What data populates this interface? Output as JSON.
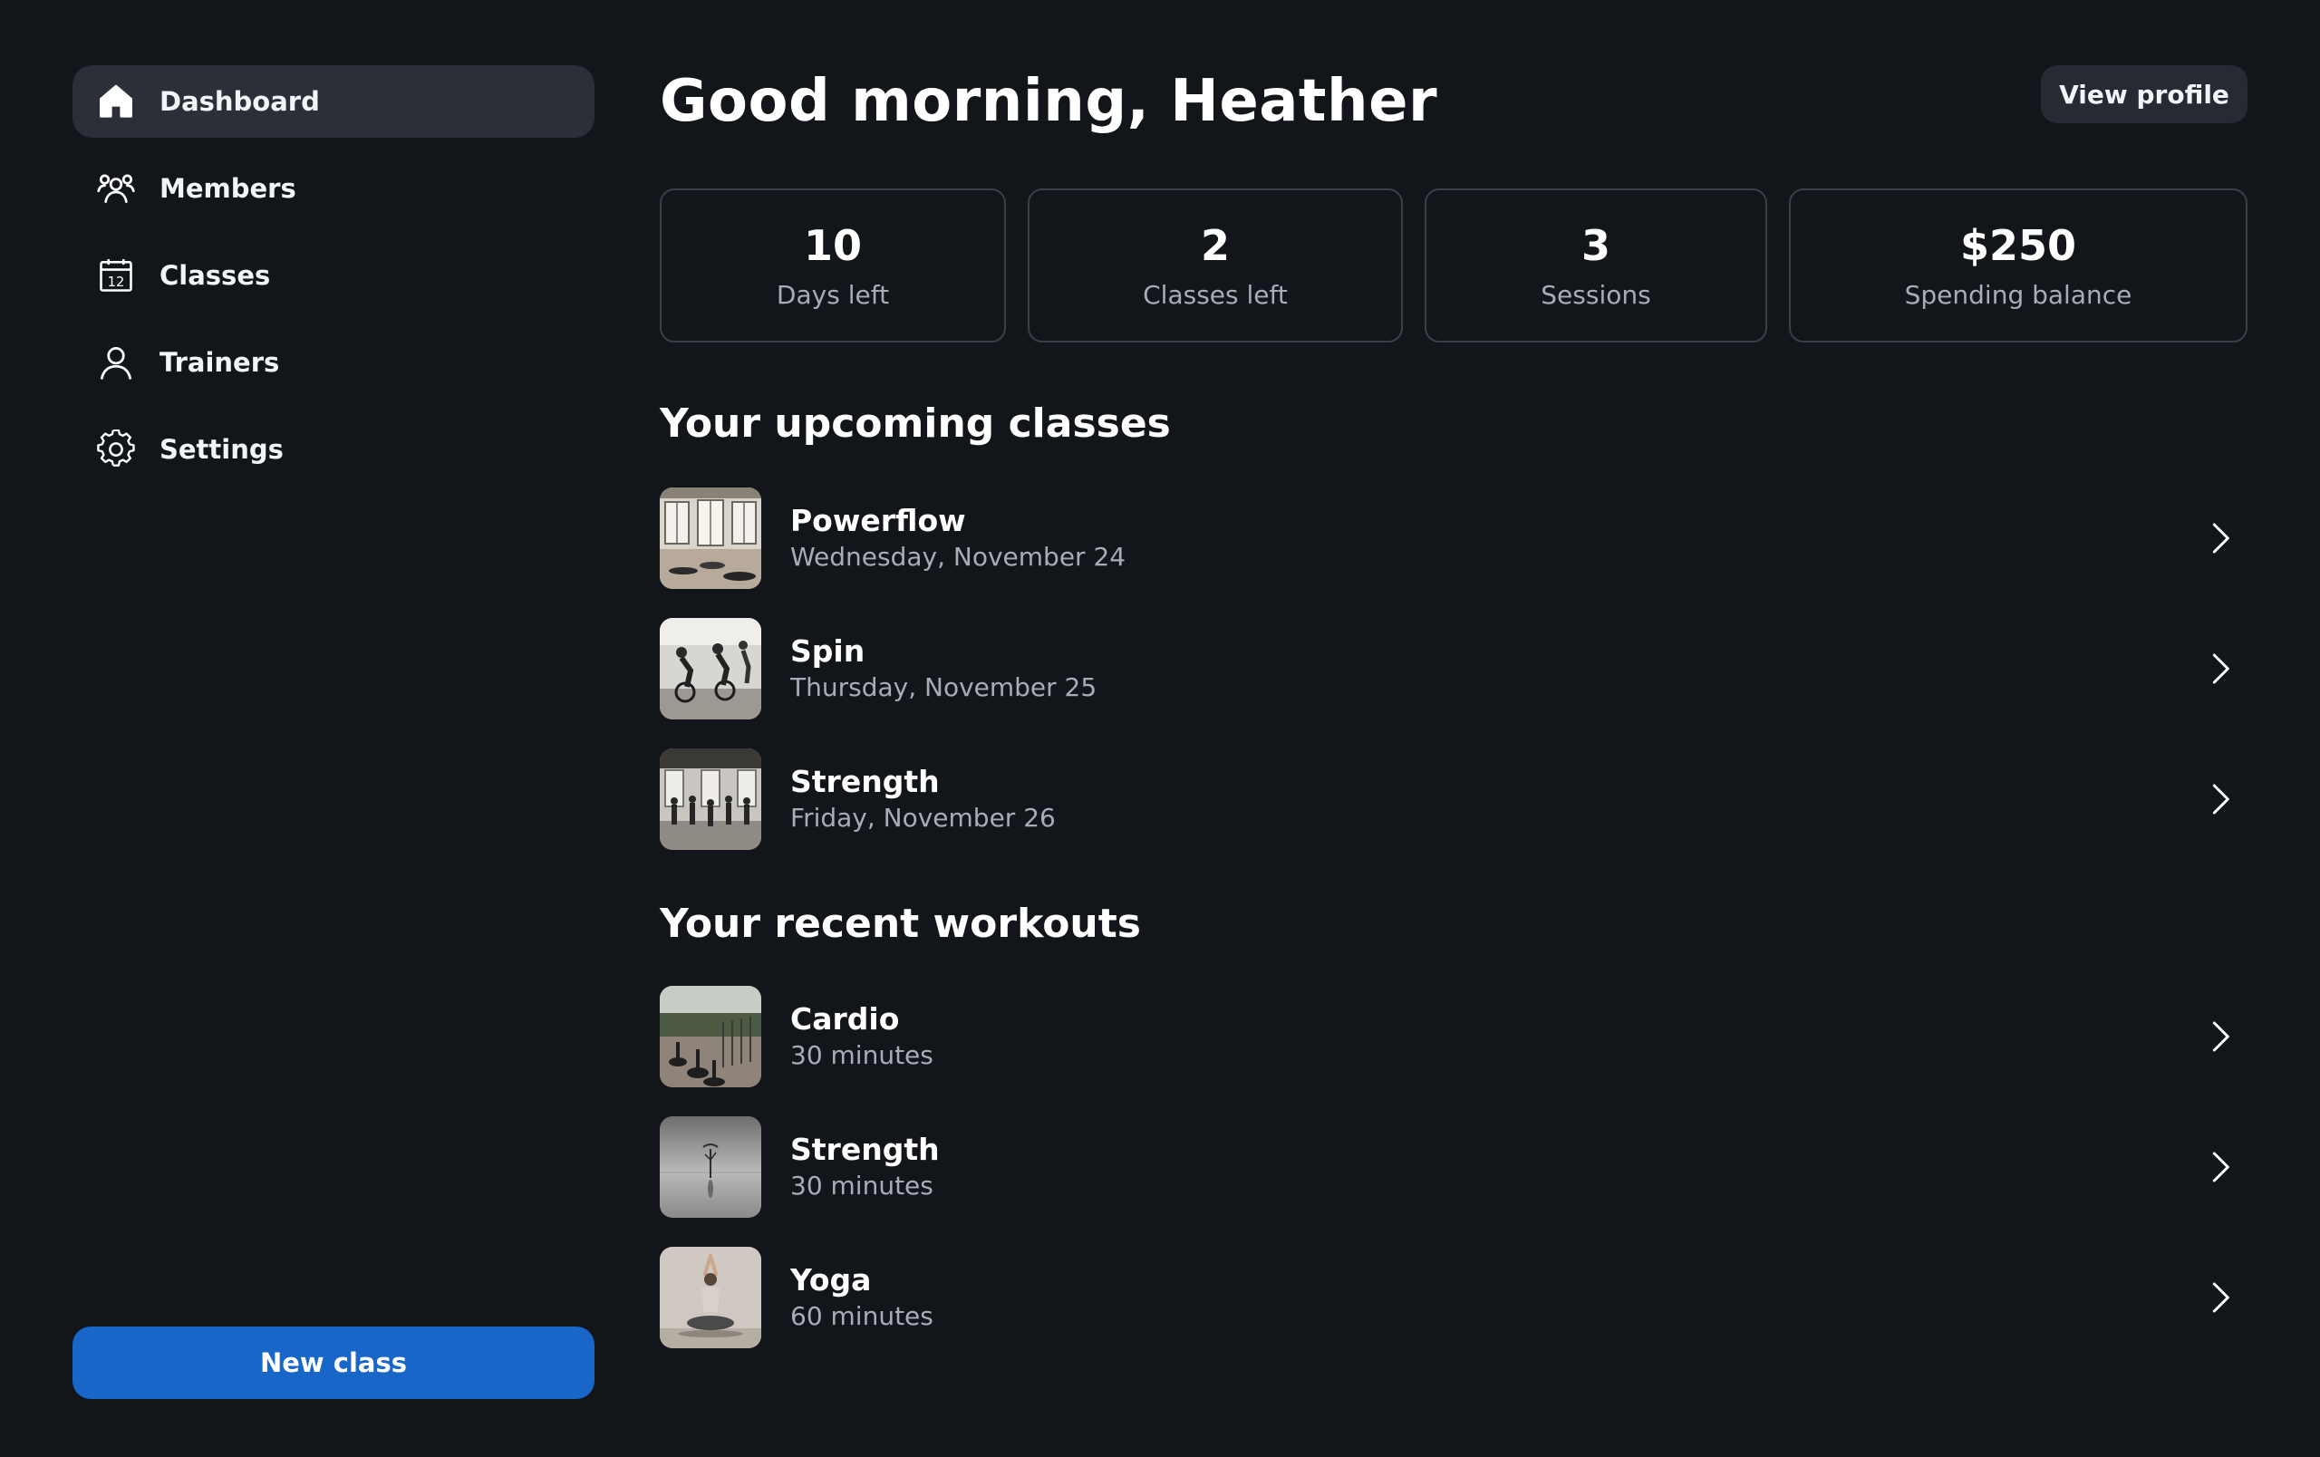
{
  "sidebar": {
    "items": [
      {
        "label": "Dashboard",
        "icon": "home-icon",
        "active": true
      },
      {
        "label": "Members",
        "icon": "members-icon",
        "active": false
      },
      {
        "label": "Classes",
        "icon": "calendar-icon",
        "active": false,
        "icon_text": "12"
      },
      {
        "label": "Trainers",
        "icon": "user-icon",
        "active": false
      },
      {
        "label": "Settings",
        "icon": "gear-icon",
        "active": false
      }
    ],
    "new_class_label": "New class"
  },
  "header": {
    "greeting": "Good morning, Heather",
    "view_profile_label": "View profile"
  },
  "stats": [
    {
      "value": "10",
      "label": "Days left"
    },
    {
      "value": "2",
      "label": "Classes left"
    },
    {
      "value": "3",
      "label": "Sessions"
    },
    {
      "value": "$250",
      "label": "Spending balance"
    }
  ],
  "upcoming": {
    "title": "Your upcoming classes",
    "items": [
      {
        "name": "Powerflow",
        "date": "Wednesday, November 24",
        "thumb": "studio-photo"
      },
      {
        "name": "Spin",
        "date": "Thursday, November 25",
        "thumb": "spin-bikes-photo"
      },
      {
        "name": "Strength",
        "date": "Friday, November 26",
        "thumb": "group-class-photo"
      }
    ]
  },
  "recent": {
    "title": "Your recent workouts",
    "items": [
      {
        "name": "Cardio",
        "duration": "30 minutes",
        "thumb": "outdoor-bikes-photo"
      },
      {
        "name": "Strength",
        "duration": "30 minutes",
        "thumb": "lone-tree-photo"
      },
      {
        "name": "Yoga",
        "duration": "60 minutes",
        "thumb": "yoga-pose-photo"
      }
    ]
  },
  "colors": {
    "background": "#12151a",
    "active_nav": "#2a2f38",
    "primary_button": "#1866c8",
    "secondary_button": "#262b33",
    "card_border": "#3a3f48",
    "muted_text": "#a7adb7"
  }
}
